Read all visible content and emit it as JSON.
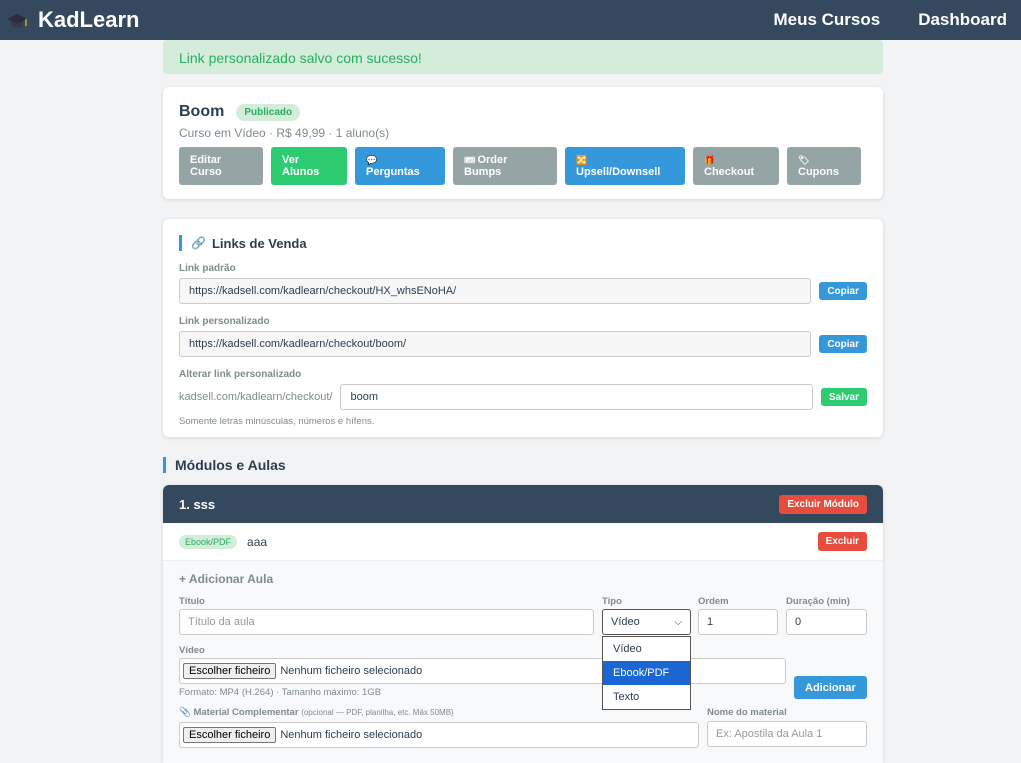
{
  "header": {
    "brand": "KadLearn",
    "nav": [
      "Meus Cursos",
      "Dashboard"
    ]
  },
  "alert": "Link personalizado salvo com sucesso!",
  "course": {
    "title": "Boom",
    "status": "Publicado",
    "meta": "Curso em Vídeo · R$ 49,99 · 1 aluno(s)",
    "actions": [
      {
        "line1": "Editar",
        "line2": "Curso",
        "icon": ""
      },
      {
        "line1": "Ver",
        "line2": "Alunos",
        "icon": ""
      },
      {
        "line1": "",
        "line2": "Perguntas",
        "icon": "speech-bubble-icon"
      },
      {
        "line1": "Order",
        "line2": "Bumps",
        "icon": "ticket-icon"
      },
      {
        "line1": "",
        "line2": "Upsell/Downsell",
        "icon": "arrows-icon"
      },
      {
        "line1": "",
        "line2": "Checkout",
        "icon": "gift-icon"
      },
      {
        "line1": "",
        "line2": "Cupons",
        "icon": "tag-icon"
      }
    ]
  },
  "links": {
    "title": "Links de Venda",
    "default_label": "Link padrão",
    "default_url": "https://kadsell.com/kadlearn/checkout/HX_whsENoHA/",
    "custom_label": "Link personalizado",
    "custom_url": "https://kadsell.com/kadlearn/checkout/boom/",
    "copy": "Copiar",
    "change_label": "Alterar link personalizado",
    "prefix": "kadsell.com/kadlearn/checkout/",
    "slug": "boom",
    "save": "Salvar",
    "hint": "Somente letras minúsculas, números e hífens."
  },
  "modules_title": "Módulos e Aulas",
  "module": {
    "name": "1. sss",
    "delete_module": "Excluir Módulo",
    "lesson": {
      "type": "Ebook/PDF",
      "title": "aaa",
      "delete": "Excluir"
    },
    "add": {
      "title": "+ Adicionar Aula",
      "title_label": "Título",
      "title_placeholder": "Título da aula",
      "type_label": "Tipo",
      "type_value": "Vídeo",
      "type_options": [
        "Vídeo",
        "Ebook/PDF",
        "Texto"
      ],
      "order_label": "Ordem",
      "order_value": "1",
      "duration_label": "Duração (min)",
      "duration_value": "0",
      "video_label": "Vídeo",
      "choose_file": "Escolher ficheiro",
      "no_file": "Nenhum ficheiro selecionado",
      "video_hint": "Formato: MP4 (H.264) · Tamanho máximo: 1GB",
      "add_button": "Adicionar",
      "material_label": "Material Complementar",
      "material_hint": "(opcional — PDF, planilha, etc. Máx 50MB)",
      "material_name_label": "Nome do material",
      "material_name_placeholder": "Ex: Apostila da Aula 1"
    }
  }
}
